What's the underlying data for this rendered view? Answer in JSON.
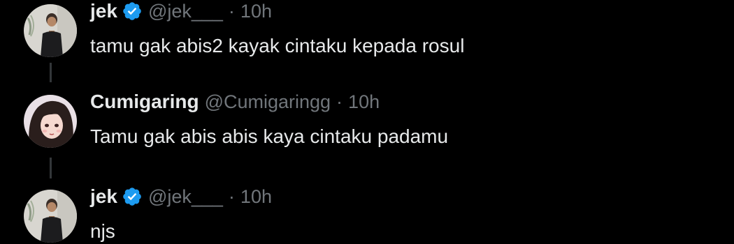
{
  "tweets": [
    {
      "name": "jek",
      "handle": "@jek___",
      "separator": "·",
      "time": "10h",
      "text": "tamu gak abis2 kayak cintaku kepada rosul",
      "verified": true,
      "avatar_icon": "person-photo-avatar"
    },
    {
      "name": "Cumigaring",
      "handle": "@Cumigaringg",
      "separator": "·",
      "time": "10h",
      "text": "Tamu gak abis abis kaya cintaku padamu",
      "verified": false,
      "avatar_icon": "anime-girl-avatar"
    },
    {
      "name": "jek",
      "handle": "@jek___",
      "separator": "·",
      "time": "10h",
      "text": "njs",
      "verified": true,
      "avatar_icon": "person-photo-avatar"
    }
  ],
  "colors": {
    "background": "#000000",
    "text_primary": "#e7e9ea",
    "text_secondary": "#71767b",
    "verified_badge": "#1d9bf0",
    "thread_line": "#333639"
  }
}
